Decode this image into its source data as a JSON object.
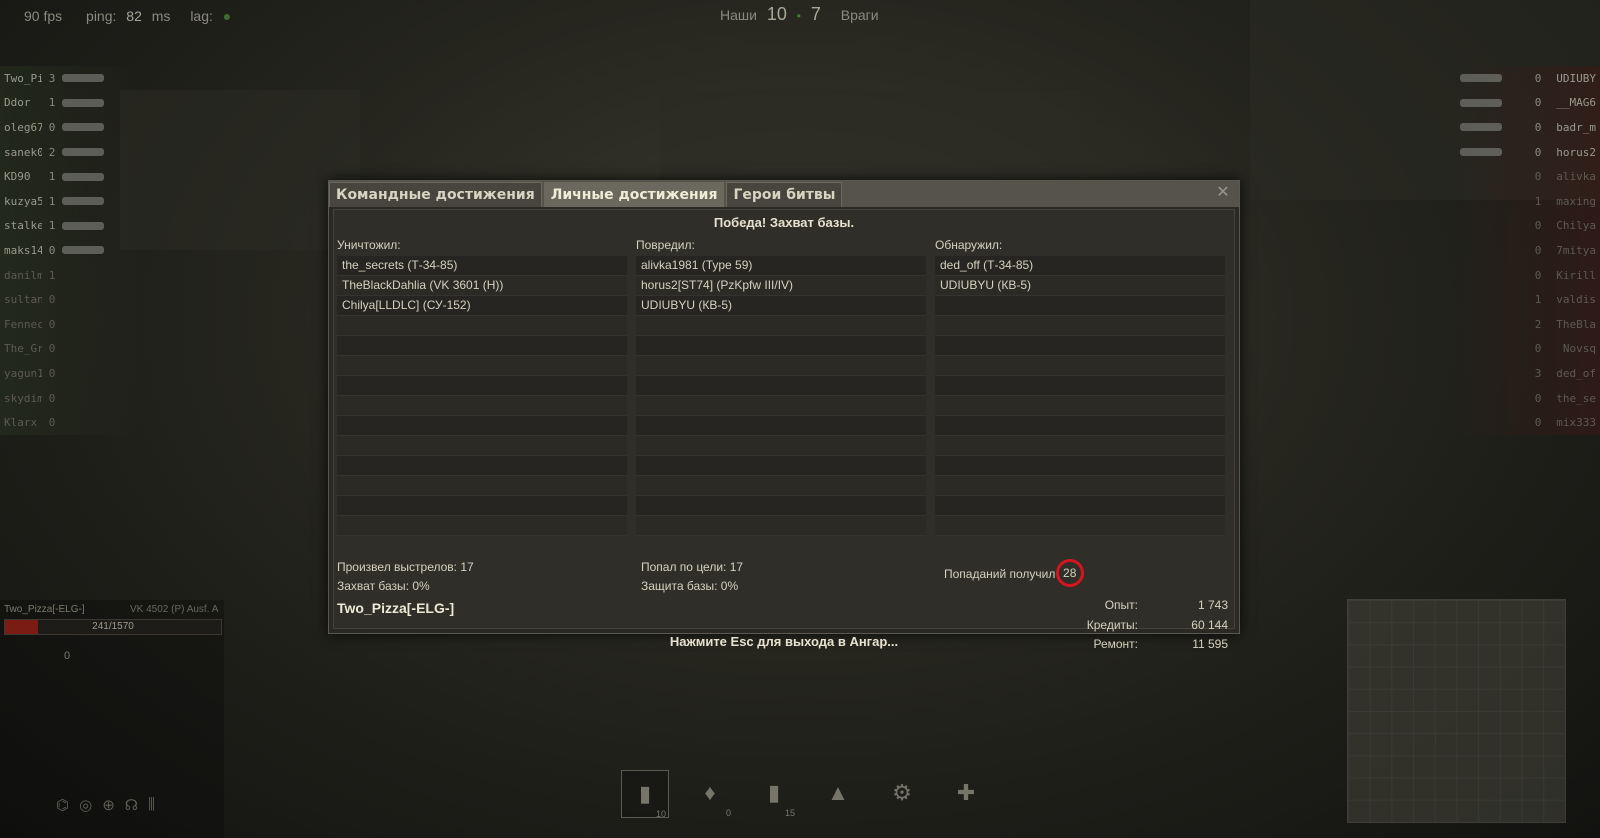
{
  "hud": {
    "fps": "90 fps",
    "ping_label": "ping:",
    "ping_value": "82",
    "ping_unit": "ms",
    "lag_label": "lag:"
  },
  "score": {
    "allies_label": "Наши",
    "allies_value": "10",
    "enemies_value": "7",
    "enemies_label": "Враги"
  },
  "team_left": [
    {
      "name": "Two_Pi",
      "frags": "3",
      "alive": true
    },
    {
      "name": "Ddor",
      "frags": "1",
      "alive": true
    },
    {
      "name": "oleg67",
      "frags": "0",
      "alive": true
    },
    {
      "name": "sanek0",
      "frags": "2",
      "alive": true
    },
    {
      "name": "KD90",
      "frags": "1",
      "alive": true
    },
    {
      "name": "kuzya5",
      "frags": "1",
      "alive": true
    },
    {
      "name": "stalke",
      "frags": "1",
      "alive": true
    },
    {
      "name": "maks14",
      "frags": "0",
      "alive": true
    },
    {
      "name": "danilm",
      "frags": "1",
      "alive": false
    },
    {
      "name": "sultan",
      "frags": "0",
      "alive": false
    },
    {
      "name": "Fennec",
      "frags": "0",
      "alive": false
    },
    {
      "name": "The_Gr",
      "frags": "0",
      "alive": false
    },
    {
      "name": "yagun1",
      "frags": "0",
      "alive": false
    },
    {
      "name": "skydim",
      "frags": "0",
      "alive": false
    },
    {
      "name": "Klarx",
      "frags": "0",
      "alive": false
    }
  ],
  "team_right": [
    {
      "name": "UDIUBY",
      "frags": "0",
      "alive": true
    },
    {
      "name": "__MAG6",
      "frags": "0",
      "alive": true
    },
    {
      "name": "badr_m",
      "frags": "0",
      "alive": true
    },
    {
      "name": "horus2",
      "frags": "0",
      "alive": true
    },
    {
      "name": "alivka",
      "frags": "0",
      "alive": false
    },
    {
      "name": "maxing",
      "frags": "1",
      "alive": false
    },
    {
      "name": "Chilya",
      "frags": "0",
      "alive": false
    },
    {
      "name": "7mitya",
      "frags": "0",
      "alive": false
    },
    {
      "name": "Kirill",
      "frags": "0",
      "alive": false
    },
    {
      "name": "valdis",
      "frags": "1",
      "alive": false
    },
    {
      "name": "TheBla",
      "frags": "2",
      "alive": false
    },
    {
      "name": "Novsq",
      "frags": "0",
      "alive": false
    },
    {
      "name": "ded_of",
      "frags": "3",
      "alive": false
    },
    {
      "name": "the_se",
      "frags": "0",
      "alive": false
    },
    {
      "name": "mix333",
      "frags": "0",
      "alive": false
    }
  ],
  "player_panel": {
    "name": "Two_Pizza[-ELG-]",
    "vehicle": "VK 4502 (P) Ausf. A",
    "hp_text": "241/1570",
    "hp_fraction": 0.153,
    "speed": "0"
  },
  "consumables": [
    {
      "icon": "shell-ap-icon",
      "glyph": "▮",
      "count": "10",
      "active": true
    },
    {
      "icon": "shell-apcr-icon",
      "glyph": "♦",
      "count": "0",
      "active": false
    },
    {
      "icon": "shell-he-icon",
      "glyph": "▮",
      "count": "15",
      "active": false
    },
    {
      "icon": "fire-extinguisher-icon",
      "glyph": "▲",
      "count": "",
      "active": false
    },
    {
      "icon": "repair-kit-icon",
      "glyph": "⚙",
      "count": "",
      "active": false
    },
    {
      "icon": "medkit-icon",
      "glyph": "✚",
      "count": "",
      "active": false
    }
  ],
  "dialog": {
    "tabs": [
      "Командные достижения",
      "Личные достижения",
      "Герои битвы"
    ],
    "active_tab": 1,
    "close_glyph": "✕",
    "result": "Победа! Захват базы.",
    "columns": [
      {
        "header": "Уничтожил:",
        "items": [
          "the_secrets (Т-34-85)",
          "TheBlackDahlia (VK 3601 (H))",
          "Chilya[LLDLC] (СУ-152)"
        ]
      },
      {
        "header": "Повредил:",
        "items": [
          "alivka1981 (Type 59)",
          "horus2[ST74] (PzKpfw III/IV)",
          "UDIUBYU (КВ-5)"
        ]
      },
      {
        "header": "Обнаружил:",
        "items": [
          "ded_off (Т-34-85)",
          "UDIUBYU (КВ-5)"
        ]
      }
    ],
    "stats": {
      "shots_fired": "Произвел выстрелов: 17",
      "base_capture": "Захват базы: 0%",
      "hits": "Попал по цели: 17",
      "base_defense": "Защита базы: 0%",
      "hits_received_label": "Попаданий получил",
      "hits_received_value": "28"
    },
    "player": "Two_Pizza[-ELG-]",
    "esc_hint": "Нажмите Esc для выхода в Ангар...",
    "rewards": [
      {
        "label": "Опыт:",
        "value": "1 743"
      },
      {
        "label": "Кредиты:",
        "value": "60 144"
      },
      {
        "label": "Ремонт:",
        "value": "11 595"
      }
    ]
  },
  "colors": {
    "highlight_circle": "#d4141e",
    "hp_fill": "#7a1c14"
  }
}
